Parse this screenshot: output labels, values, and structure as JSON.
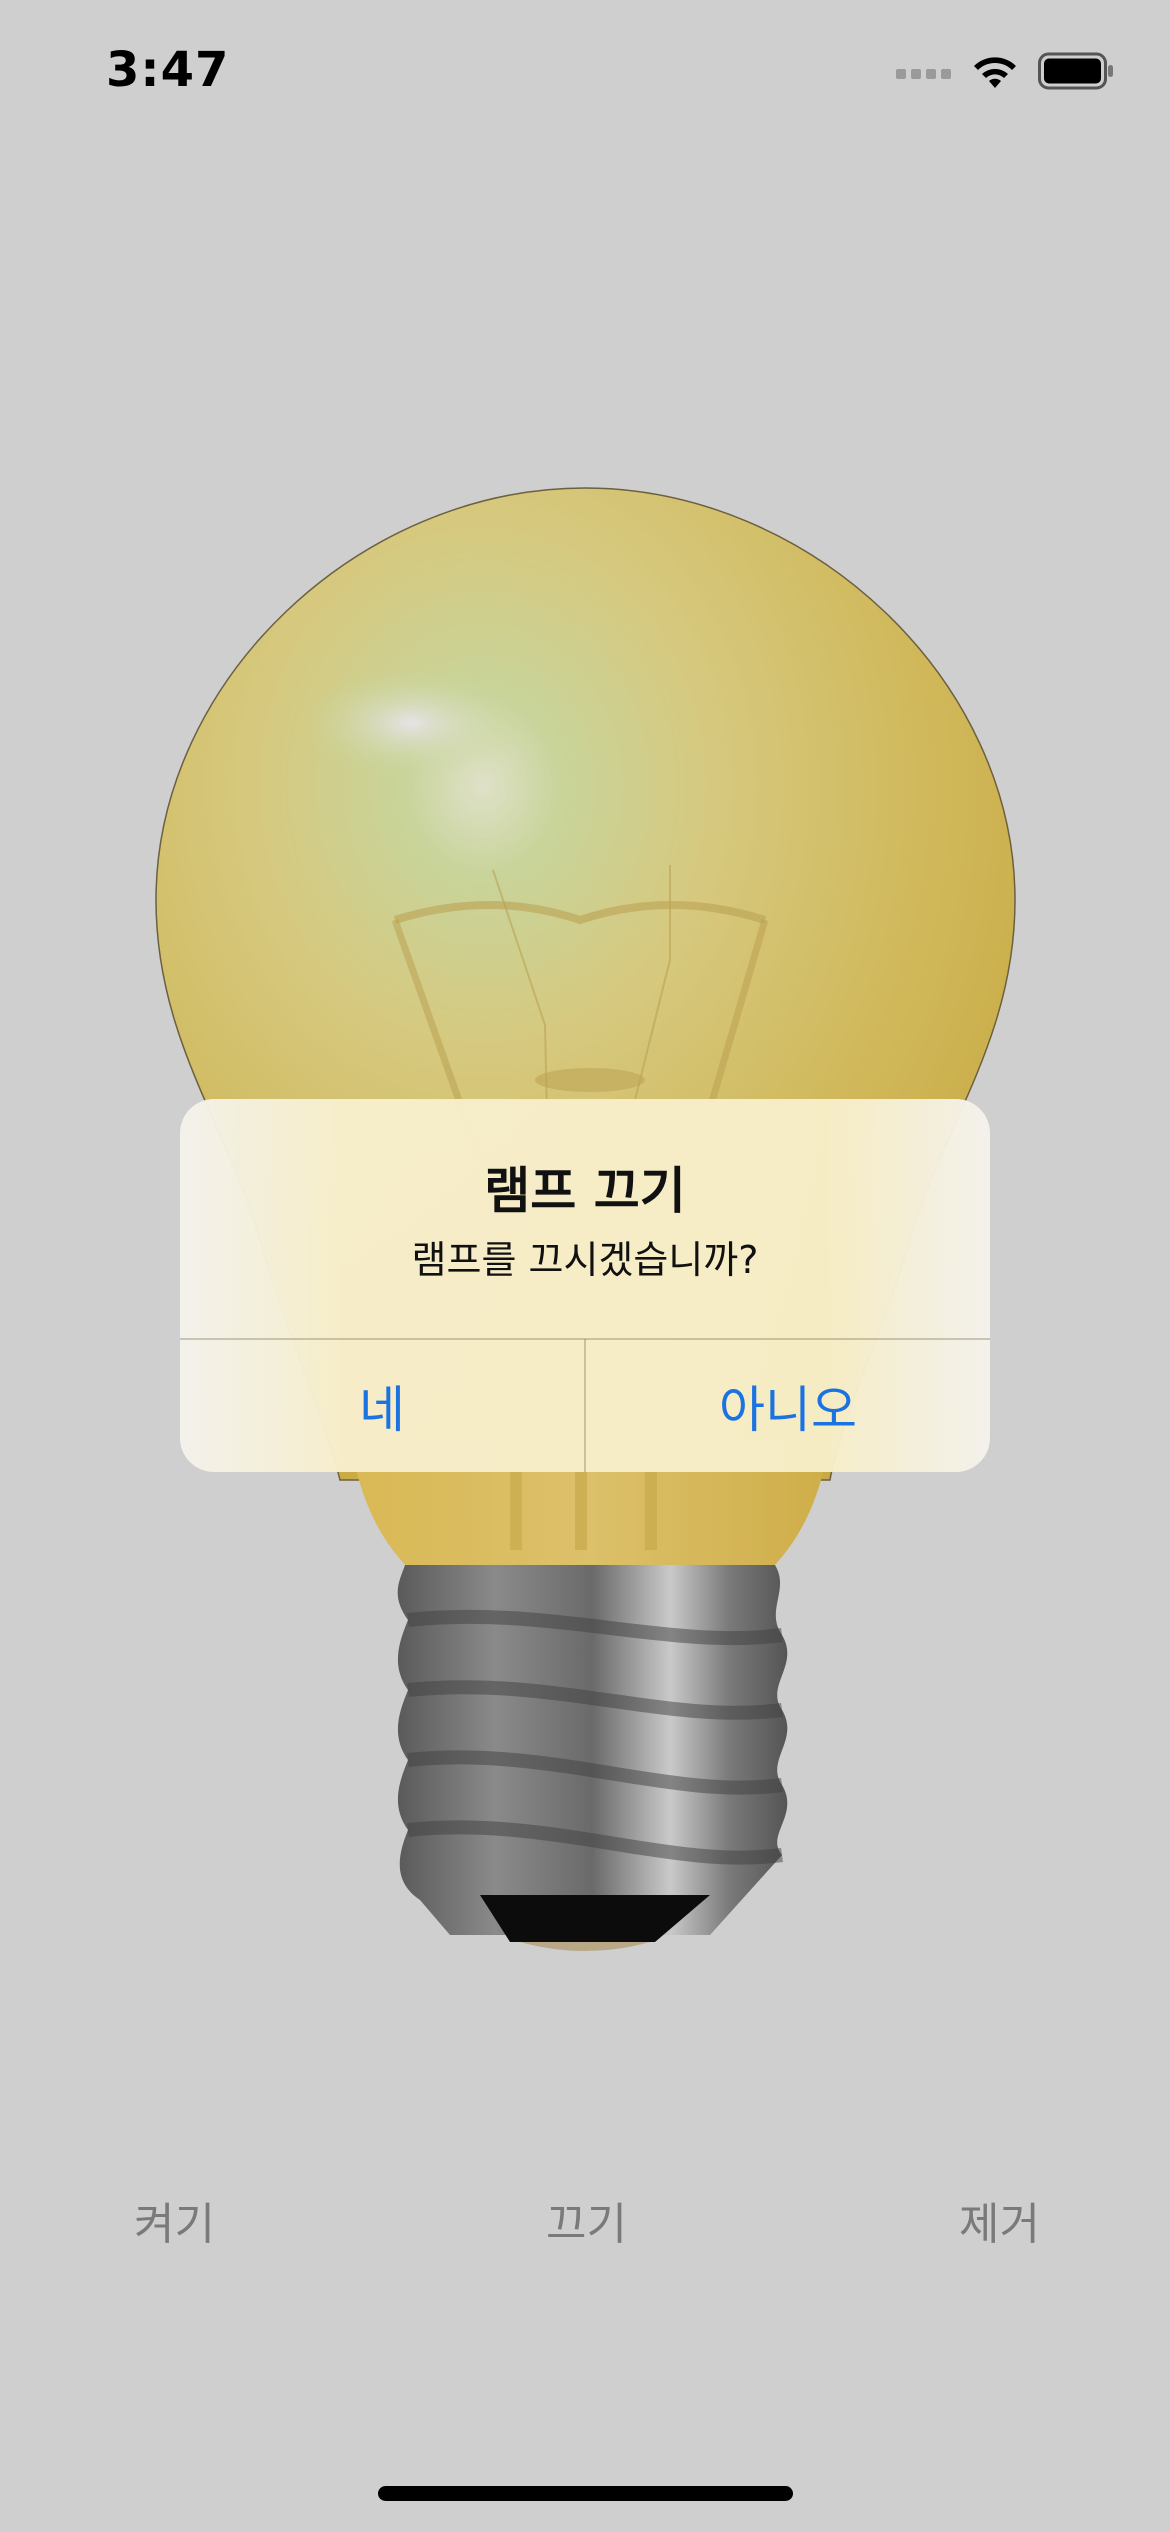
{
  "status_bar": {
    "time": "3:47",
    "icons": [
      "cellular-signal-icon",
      "wifi-icon",
      "battery-icon"
    ]
  },
  "image": {
    "name": "lightbulb",
    "state": "on"
  },
  "alert": {
    "title": "램프 끄기",
    "message": "램프를 끄시겠습니까?",
    "buttons": {
      "yes": "네",
      "no": "아니오"
    },
    "button_color": "#1a73e0"
  },
  "bottom_buttons": {
    "on": "켜기",
    "off": "끄기",
    "remove": "제거"
  }
}
